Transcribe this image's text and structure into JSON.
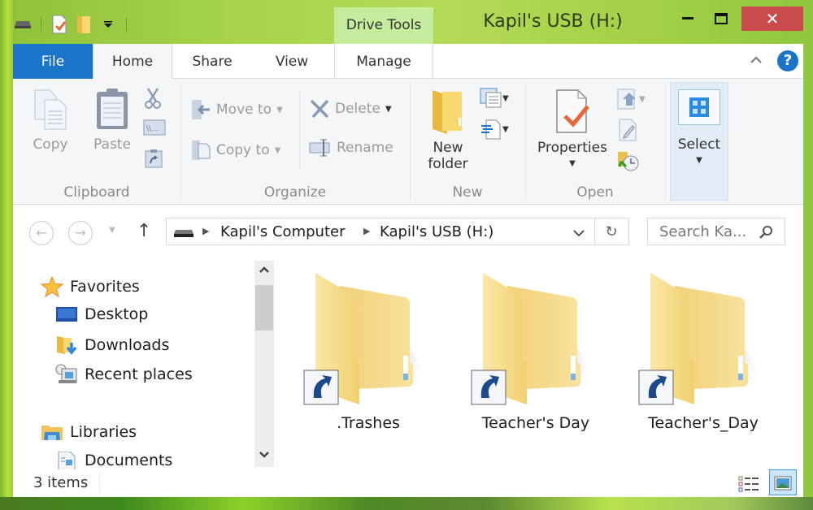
{
  "window": {
    "title": "Kapil's USB (H:)",
    "contextual_tab_group": "Drive Tools",
    "controls": {
      "minimize": "minimize",
      "maximize": "maximize",
      "close": "✕"
    }
  },
  "quick_access_toolbar": {
    "items": [
      "drive-icon",
      "properties-icon",
      "new-folder-icon",
      "customize-dropdown-icon"
    ]
  },
  "ribbon": {
    "tabs": [
      {
        "label": "File"
      },
      {
        "label": "Home",
        "active": true
      },
      {
        "label": "Share"
      },
      {
        "label": "View"
      },
      {
        "label": "Manage"
      }
    ],
    "collapse_glyph": "^",
    "help_glyph": "?",
    "groups": {
      "clipboard": {
        "label": "Clipboard",
        "copy": "Copy",
        "paste": "Paste",
        "small_buttons": [
          "cut",
          "copy-path",
          "paste-shortcut"
        ]
      },
      "organize": {
        "label": "Organize",
        "move_to": "Move to",
        "copy_to": "Copy to",
        "delete": "Delete",
        "rename": "Rename"
      },
      "new": {
        "label": "New",
        "new_folder_line1": "New",
        "new_folder_line2": "folder"
      },
      "open": {
        "label": "Open",
        "properties": "Properties"
      },
      "select": {
        "label": "Select"
      }
    }
  },
  "navigation": {
    "breadcrumb": [
      "Kapil's Computer",
      "Kapil's USB (H:)"
    ],
    "search_placeholder": "Search Ka..."
  },
  "nav_pane": {
    "favorites": {
      "label": "Favorites",
      "items": [
        "Desktop",
        "Downloads",
        "Recent places"
      ]
    },
    "libraries": {
      "label": "Libraries",
      "items": [
        "Documents"
      ]
    }
  },
  "files": [
    {
      "name": ".Trashes",
      "type": "folder-shortcut"
    },
    {
      "name": "Teacher's Day",
      "type": "folder-shortcut"
    },
    {
      "name": "Teacher's_Day",
      "type": "folder-shortcut"
    }
  ],
  "status_bar": {
    "item_count": "3 items",
    "active_view": "large-icons"
  },
  "colors": {
    "accent": "#1a74c7",
    "close_button": "#c94b4b",
    "contextual_tab": "#c4ec9c",
    "folder_yellow": "#f5d778"
  }
}
